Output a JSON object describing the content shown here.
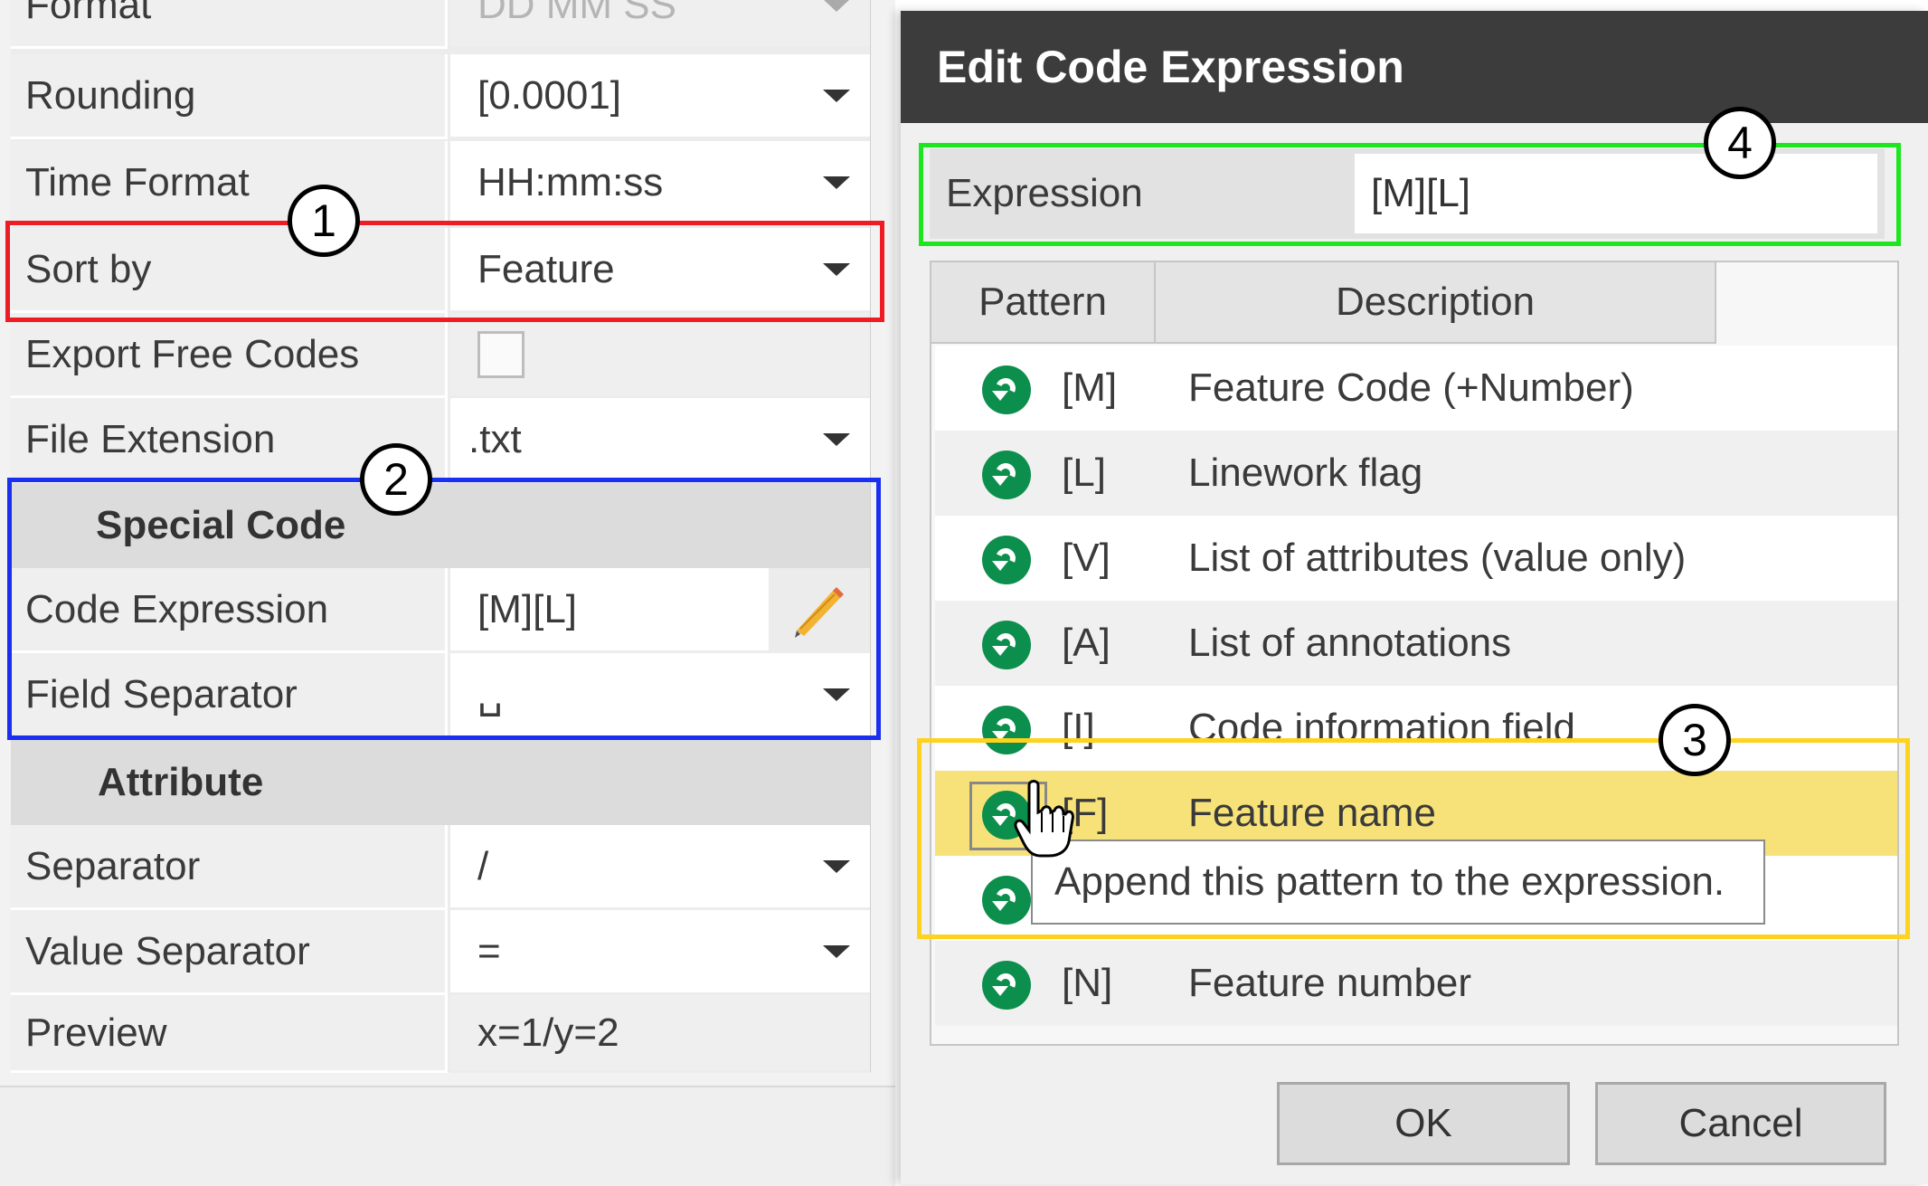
{
  "properties": {
    "rows": [
      {
        "label": "Format",
        "value": "DD MM SS"
      },
      {
        "label": "Rounding",
        "value": "[0.0001]"
      },
      {
        "label": "Time Format",
        "value": "HH:mm:ss"
      },
      {
        "label": "Sort by",
        "value": "Feature"
      },
      {
        "label": "Export Free Codes",
        "value": ""
      },
      {
        "label": "File Extension",
        "value": ".txt"
      }
    ],
    "special_code": {
      "header": "Special Code",
      "code_expression_label": "Code Expression",
      "code_expression_value": "[M][L]",
      "field_separator_label": "Field Separator",
      "field_separator_value": "␣"
    },
    "attribute": {
      "header": "Attribute",
      "separator_label": "Separator",
      "separator_value": "/",
      "value_separator_label": "Value Separator",
      "value_separator_value": "=",
      "preview_label": "Preview",
      "preview_value": "x=1/y=2"
    }
  },
  "annotations": {
    "n1": "1",
    "n2": "2",
    "n3": "3",
    "n4": "4",
    "colors": {
      "red": "#ee1c24",
      "blue": "#1a2ff0",
      "green": "#1ee61e",
      "yellow": "#ffd21e"
    }
  },
  "dialog": {
    "title": "Edit Code Expression",
    "expression_label": "Expression",
    "expression_value": "[M][L]",
    "columns": {
      "pattern": "Pattern",
      "description": "Description"
    },
    "patterns": [
      {
        "pattern": "[M]",
        "description": "Feature Code (+Number)"
      },
      {
        "pattern": "[L]",
        "description": "Linework flag"
      },
      {
        "pattern": "[V]",
        "description": "List of attributes (value only)"
      },
      {
        "pattern": "[A]",
        "description": "List of annotations"
      },
      {
        "pattern": "[I]",
        "description": "Code information field"
      },
      {
        "pattern": "[F]",
        "description": "Feature name"
      },
      {
        "pattern": "",
        "description": ""
      },
      {
        "pattern": "[N]",
        "description": "Feature number"
      }
    ],
    "tooltip": "Append this pattern to the expression.",
    "ok_label": "OK",
    "cancel_label": "Cancel"
  }
}
